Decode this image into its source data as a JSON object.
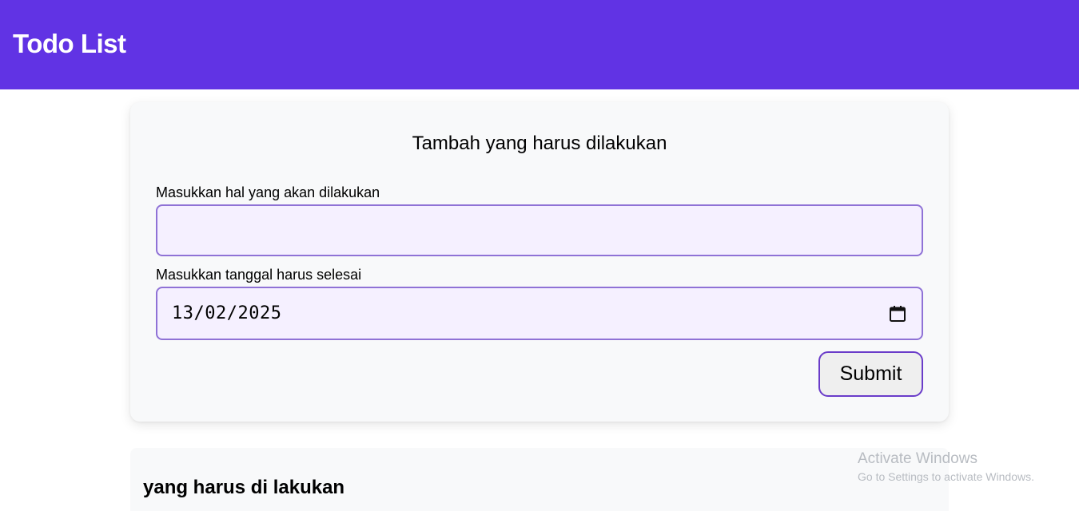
{
  "header": {
    "title": "Todo List"
  },
  "form": {
    "title": "Tambah yang harus dilakukan",
    "todo_label": "Masukkan hal yang akan dilakukan",
    "todo_value": "",
    "date_label": "Masukkan tanggal harus selesai",
    "date_value": "13/02/2025",
    "submit_label": "Submit",
    "calendar_icon": "calendar-icon"
  },
  "todo_section": {
    "title": "yang harus di lakukan"
  },
  "watermark": {
    "title": "Activate Windows",
    "subtitle": "Go to Settings to activate Windows."
  },
  "colors": {
    "header_bg": "#6133e4",
    "input_bg": "#f5f0ff",
    "input_border": "#8f72d6",
    "button_border": "#6a3cc9",
    "card_bg": "#f8f9fa"
  }
}
